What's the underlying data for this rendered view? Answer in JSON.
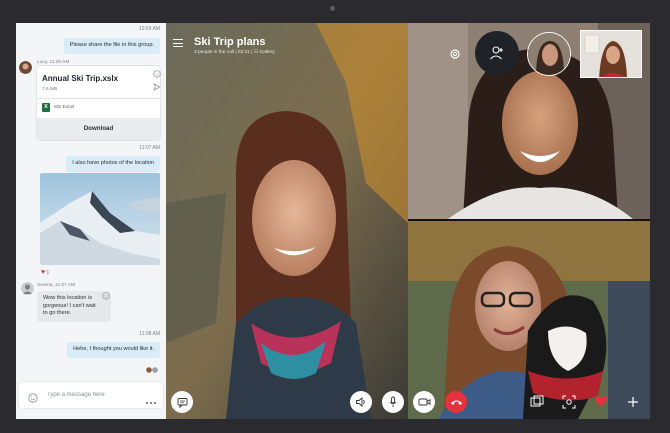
{
  "chat": {
    "messages": [
      {
        "time": "10:59 AM",
        "text": "Please share the file in this group."
      },
      {
        "sender": "Lucy, 11:00 AM"
      },
      {
        "time": "11:07 AM",
        "text": "I also have photos of the location"
      },
      {
        "reaction_count": "1"
      },
      {
        "sender": "Serena, 11:07 AM",
        "text_lines": [
          "Wow this location is",
          "gorgeous! I can't wait",
          "to go there."
        ]
      },
      {
        "time": "11:08 AM",
        "text": "Hehe, I thought you would like it."
      }
    ],
    "file": {
      "name": "Annual Ski Trip.xslx",
      "size": "7.6 MB",
      "app": "MS Excel",
      "download_label": "Download"
    },
    "composer": {
      "placeholder": "Type a message here"
    }
  },
  "call": {
    "title": "Ski Trip plans",
    "subtitle": "3 people in the call | 02:21 | ☷ Gallery"
  },
  "colors": {
    "accent": "#0078d4",
    "end_call": "#e6323c",
    "bubble_out": "#d8ecf8"
  }
}
